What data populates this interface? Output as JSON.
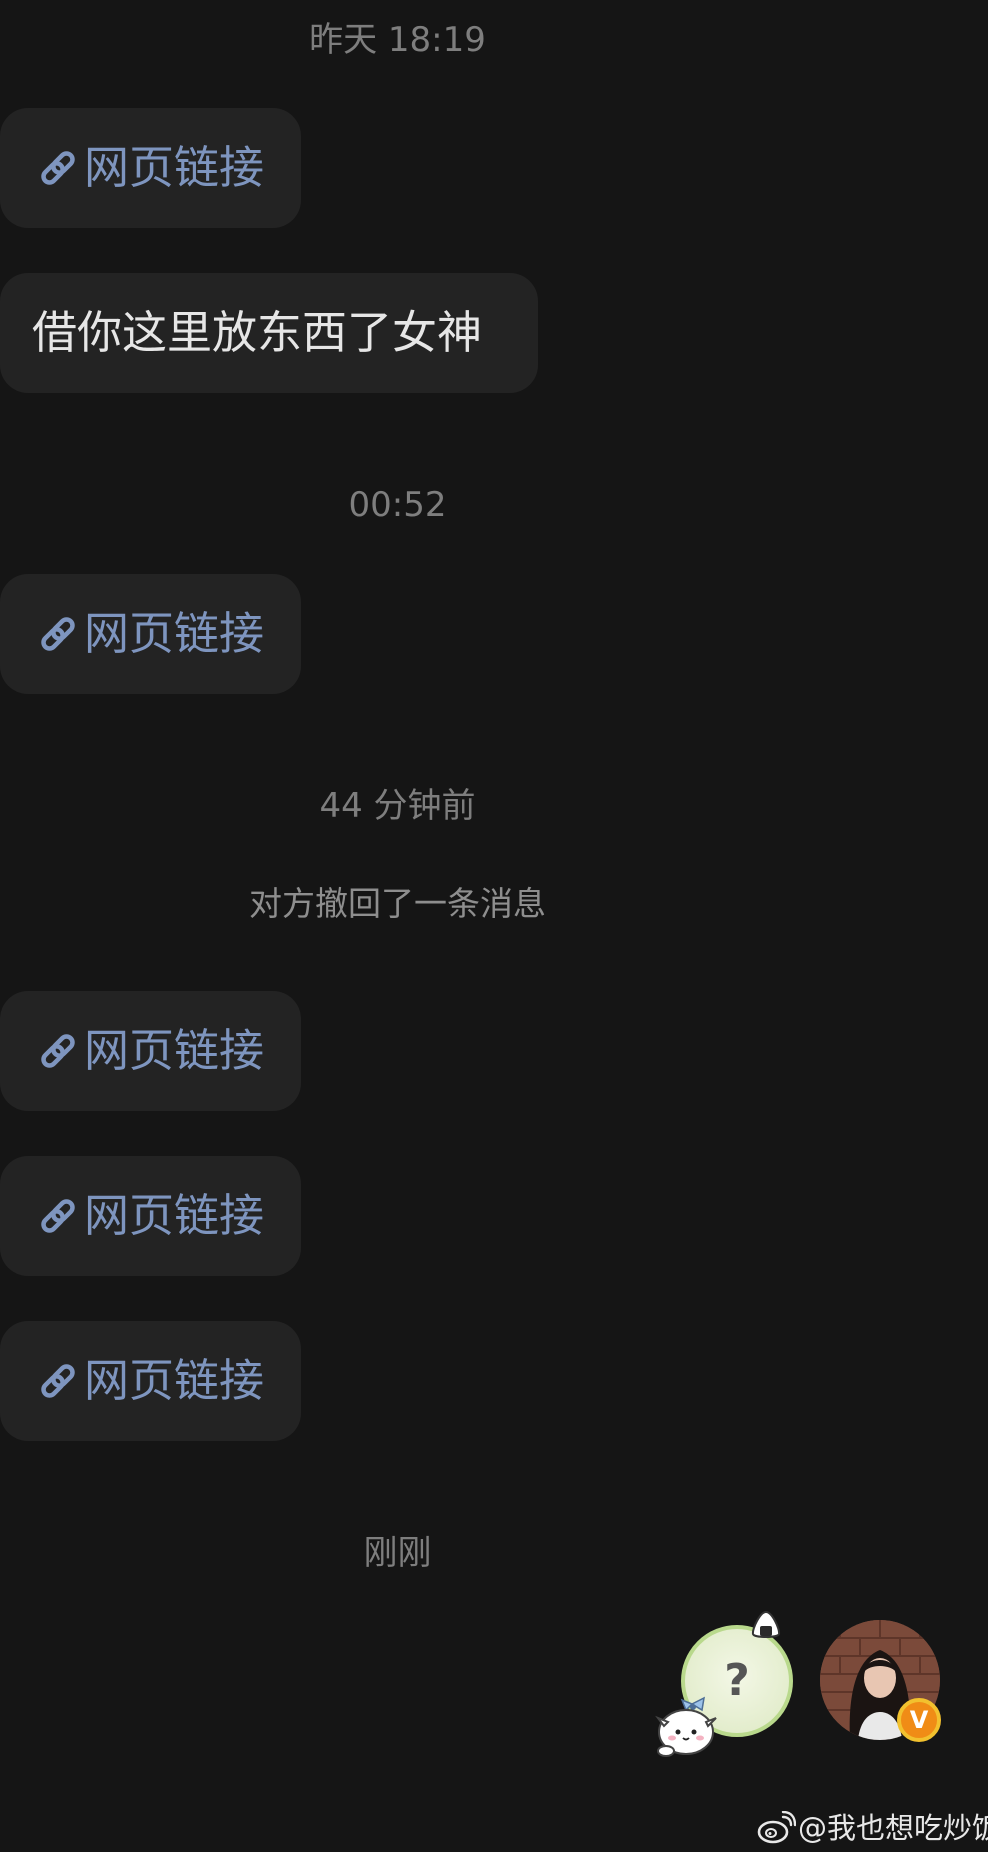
{
  "chat": {
    "timestamps": {
      "yesterday": "昨天 18:19",
      "midnight": "00:52",
      "minutes_ago": "44 分钟前",
      "just_now": "刚刚"
    },
    "messages": {
      "link_1": "网页链接",
      "text_1": "借你这里放东西了女神",
      "link_2": "网页链接",
      "link_3": "网页链接",
      "link_4": "网页链接",
      "link_5": "网页链接"
    },
    "system_notice": "对方撤回了一条消息"
  },
  "floating": {
    "help_button_glyph": "?",
    "verified_badge": "V"
  },
  "watermark": {
    "handle": "@我也想吃炒饭"
  },
  "colors": {
    "background": "#151515",
    "bubble": "#232323",
    "link_text": "#7e95bf",
    "message_text": "#e6e6e6",
    "timestamp": "#7e7e7e",
    "verified_badge": "#f08c16"
  }
}
